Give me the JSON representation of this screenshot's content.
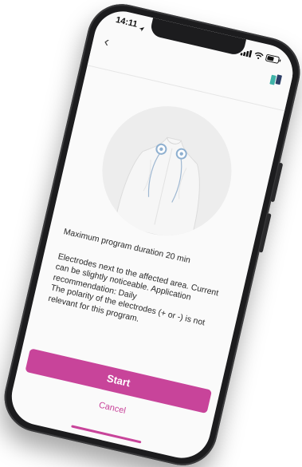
{
  "status_bar": {
    "time": "14:11",
    "location_icon": "navigation-arrow-icon",
    "signal_icon": "cellular-signal-icon",
    "wifi_icon": "wifi-icon",
    "battery_icon": "battery-icon"
  },
  "header": {
    "back_icon": "chevron-left-icon",
    "back_glyph": "‹",
    "logo_icon": "brand-logo-icon"
  },
  "program": {
    "duration_text": "Maximum program duration 20 min",
    "description": "Electrodes next to the affected area. Current can be slightly noticeable. Application recommendation: Daily\nThe polarity of the electrodes (+ or -) is not relevant for this program.",
    "illustration": "upper-back-electrode-placement"
  },
  "actions": {
    "start_label": "Start",
    "cancel_label": "Cancel"
  },
  "colors": {
    "accent": "#c8449a",
    "phone_frame": "#1c1c1e",
    "screen_background": "#fafafa",
    "illustration_background": "#ededed",
    "logo_teal": "#3fb3a8",
    "logo_navy": "#2c3e66"
  }
}
